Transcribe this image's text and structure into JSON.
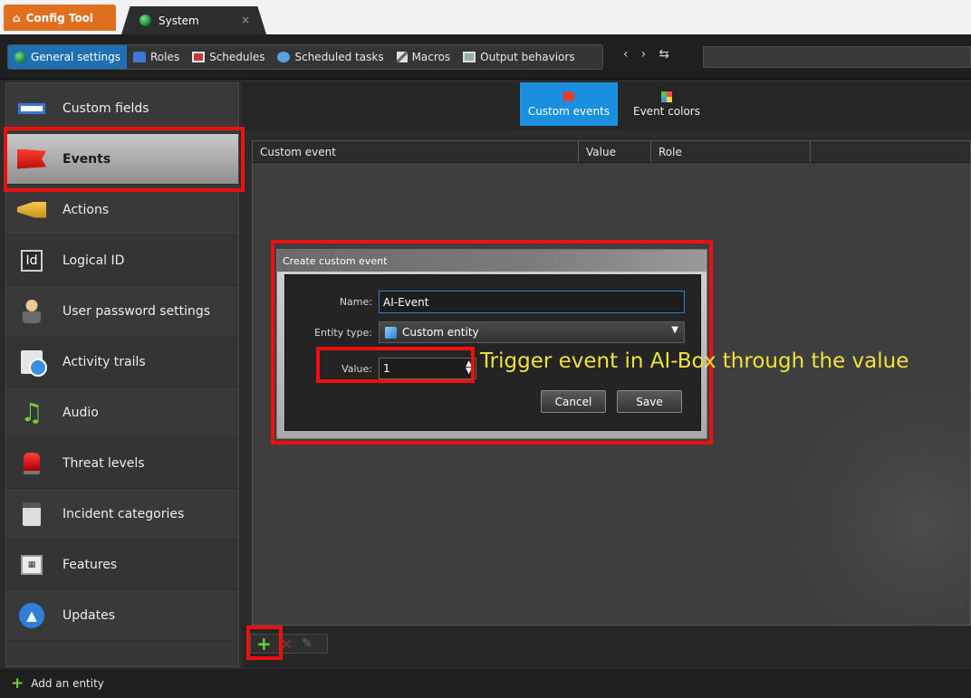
{
  "app_tabs": {
    "config_tool": "Config Tool",
    "system": "System",
    "close": "×"
  },
  "toolbar": {
    "items": [
      {
        "label": "General settings",
        "icon": "globe-icon",
        "active": true
      },
      {
        "label": "Roles",
        "icon": "roles-icon"
      },
      {
        "label": "Schedules",
        "icon": "calendar-icon"
      },
      {
        "label": "Scheduled tasks",
        "icon": "tasks-icon"
      },
      {
        "label": "Macros",
        "icon": "macros-icon"
      },
      {
        "label": "Output behaviors",
        "icon": "output-icon"
      }
    ],
    "back": "‹",
    "forward": "›",
    "history": "⇆"
  },
  "sidebar": {
    "items": [
      {
        "label": "Custom fields",
        "icon": "custom-fields-icon"
      },
      {
        "label": "Events",
        "icon": "red-flag-icon",
        "selected": true
      },
      {
        "label": "Actions",
        "icon": "megaphone-icon"
      },
      {
        "label": "Logical ID",
        "icon": "id-icon",
        "glyph": "Id"
      },
      {
        "label": "User password settings",
        "icon": "user-icon"
      },
      {
        "label": "Activity trails",
        "icon": "activity-trail-icon"
      },
      {
        "label": "Audio",
        "icon": "music-note-icon",
        "glyph": "♫"
      },
      {
        "label": "Threat levels",
        "icon": "alarm-light-icon"
      },
      {
        "label": "Incident categories",
        "icon": "clipboard-icon"
      },
      {
        "label": "Features",
        "icon": "features-icon",
        "glyph": "▦"
      },
      {
        "label": "Updates",
        "icon": "cloud-upload-icon",
        "glyph": "▲"
      }
    ]
  },
  "main_tabs": [
    {
      "label": "Custom events",
      "icon": "flag-icon",
      "active": true
    },
    {
      "label": "Event colors",
      "icon": "color-palette-icon"
    }
  ],
  "table": {
    "columns": [
      "Custom event",
      "Value",
      "Role"
    ],
    "rows": []
  },
  "bottom_toolbar": {
    "add": "+",
    "delete": "✕",
    "edit": "✎"
  },
  "status_bar": {
    "add_entity": "Add an entity"
  },
  "dialog": {
    "title": "Create custom event",
    "name_label": "Name:",
    "name_value": "AI-Event",
    "entity_type_label": "Entity type:",
    "entity_type_value": "Custom entity",
    "value_label": "Value:",
    "value_value": "1",
    "cancel": "Cancel",
    "save": "Save"
  },
  "annotation": {
    "text": "Trigger event in AI-Box through the value",
    "highlight_color": "#ee0f0f",
    "text_color": "#f1e23a"
  },
  "colors": {
    "accent_blue": "#1a8fe0",
    "config_tab_orange": "#e0701f",
    "add_green": "#67d23b"
  }
}
